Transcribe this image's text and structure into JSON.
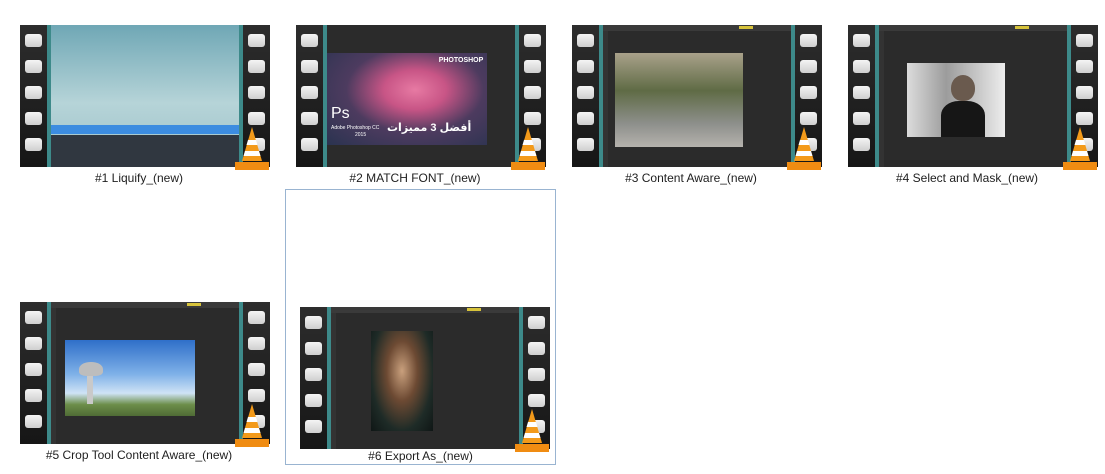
{
  "files": [
    {
      "name": "#1 Liquify_(new)",
      "thumb": "photoshop-cc-splash"
    },
    {
      "name": "#2 MATCH FONT_(new)",
      "thumb": "pink-tree-photoshop",
      "overlay": {
        "ps": "Ps",
        "app": "Adobe Photoshop CC",
        "year": "2015",
        "badge": "PHOTOSHOP",
        "arabic": "أفضل 3 مميزات"
      }
    },
    {
      "name": "#3 Content Aware_(new)",
      "thumb": "park-path"
    },
    {
      "name": "#4 Select and Mask_(new)",
      "thumb": "bw-portrait"
    },
    {
      "name": "#5 Crop Tool  Content Aware_(new)",
      "thumb": "blue-sky-monument"
    },
    {
      "name": "#6 Export As_(new)",
      "thumb": "color-portrait"
    }
  ],
  "selected_index": 5,
  "icon": "vlc-cone-icon"
}
